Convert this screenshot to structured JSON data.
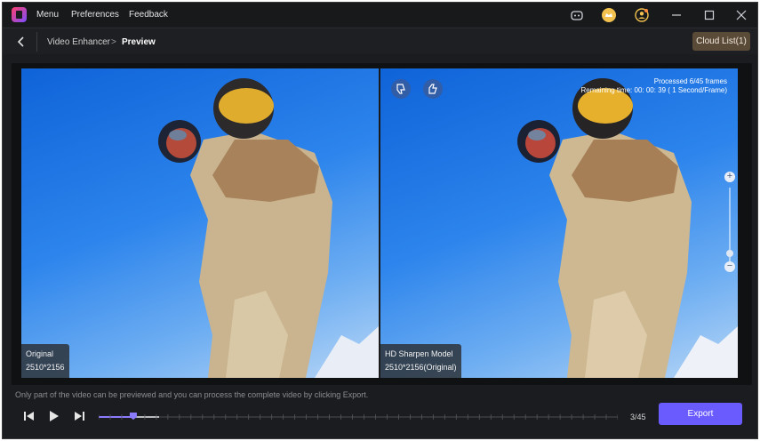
{
  "titlebar": {
    "menu_label": "Menu",
    "preferences_label": "Preferences",
    "feedback_label": "Feedback",
    "icons": [
      "discord-icon",
      "crown-icon",
      "user-icon",
      "minimize-icon",
      "maximize-icon",
      "close-icon"
    ]
  },
  "breadcrumb": {
    "parent": "Video Enhancer",
    "separator": ">",
    "current": "Preview"
  },
  "cloud_list_label": "Cloud List(1)",
  "left_pane": {
    "title": "Original",
    "resolution": "2510*2156"
  },
  "right_pane": {
    "title": "HD Sharpen Model",
    "resolution": "2510*2156(Original)",
    "processed": "Processed 6/45 frames",
    "remaining": "Remaining time: 00: 00: 39 ( 1 Second/Frame)",
    "zoom_plus": "+",
    "zoom_minus": "−",
    "zoom_level": 0.15
  },
  "hint": "Only part of the video can be previewed and you can process the complete video by clicking Export.",
  "timeline": {
    "current_frame": 3,
    "total_frames": 45,
    "counter": "3/45"
  },
  "export_label": "Export",
  "colors": {
    "accent": "#6a5bff",
    "cloud_button": "#5a4a38",
    "background": "#1b1c1f"
  }
}
